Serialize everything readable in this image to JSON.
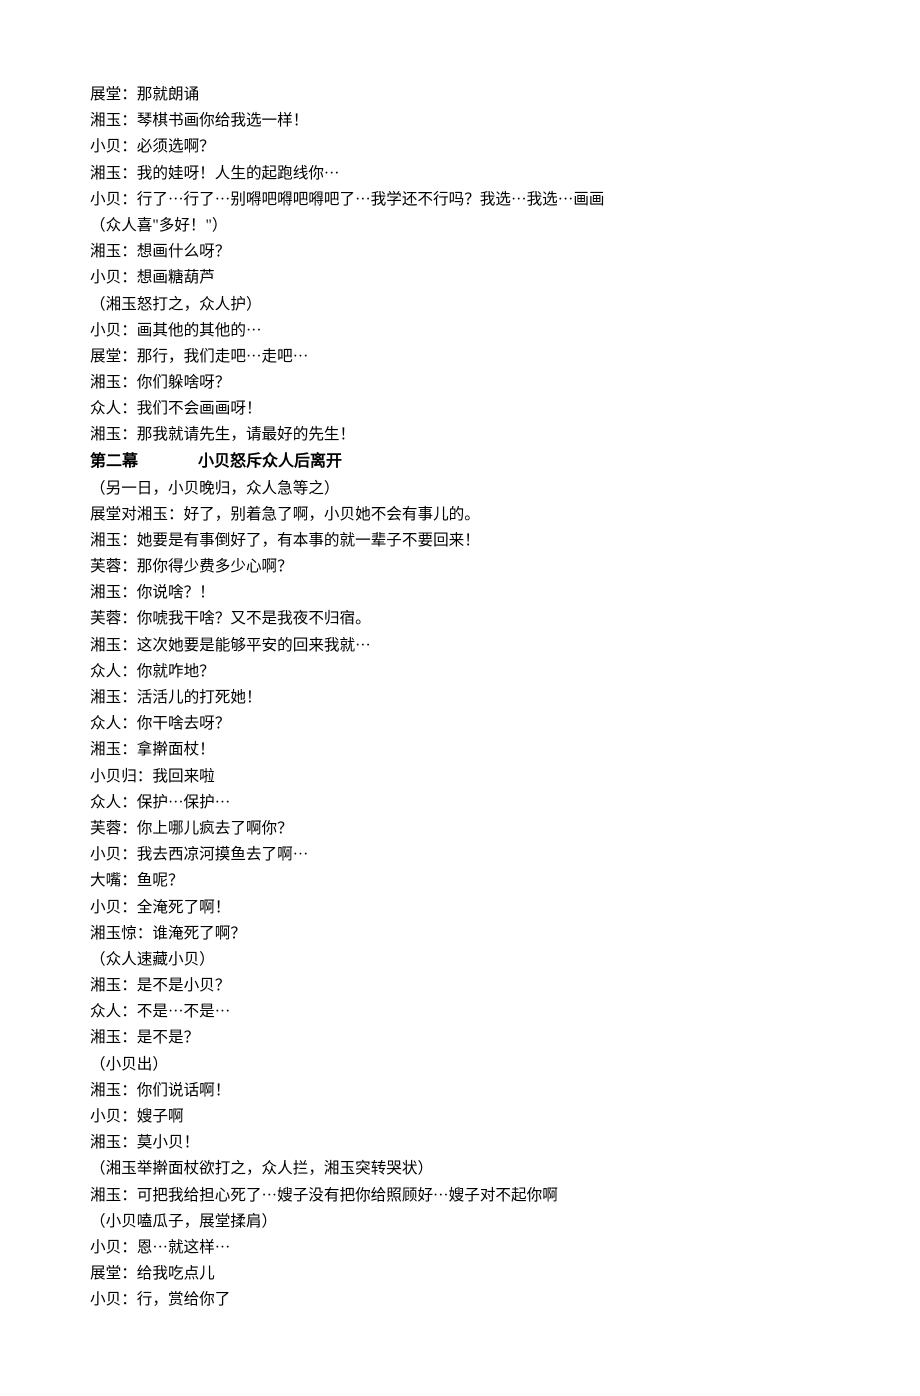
{
  "lines": [
    {
      "t": "展堂：那就朗诵"
    },
    {
      "t": "湘玉：琴棋书画你给我选一样！"
    },
    {
      "t": "小贝：必须选啊？"
    },
    {
      "t": "湘玉：我的娃呀！人生的起跑线你···"
    },
    {
      "t": "小贝：行了···行了···别嘚吧嘚吧嘚吧了···我学还不行吗？我选···我选···画画"
    },
    {
      "t": "（众人喜\"多好！\"）"
    },
    {
      "t": "湘玉：想画什么呀？"
    },
    {
      "t": "小贝：想画糖葫芦"
    },
    {
      "t": "（湘玉怒打之，众人护）"
    },
    {
      "t": "小贝：画其他的其他的···"
    },
    {
      "t": "展堂：那行，我们走吧···走吧···"
    },
    {
      "t": "湘玉：你们躲啥呀？"
    },
    {
      "t": "众人：我们不会画画呀！"
    },
    {
      "t": "湘玉：那我就请先生，请最好的先生！"
    },
    {
      "t": "第二幕",
      "t2": "小贝怒斥众人后离开",
      "h": true
    },
    {
      "t": "（另一日，小贝晚归，众人急等之）"
    },
    {
      "t": "展堂对湘玉：好了，别着急了啊，小贝她不会有事儿的。"
    },
    {
      "t": "湘玉：她要是有事倒好了，有本事的就一辈子不要回来！"
    },
    {
      "t": "芙蓉：那你得少费多少心啊？"
    },
    {
      "t": "湘玉：你说啥？！"
    },
    {
      "t": "芙蓉：你唬我干啥？又不是我夜不归宿。"
    },
    {
      "t": "湘玉：这次她要是能够平安的回来我就···"
    },
    {
      "t": "众人：你就咋地？"
    },
    {
      "t": "湘玉：活活儿的打死她！"
    },
    {
      "t": "众人：你干啥去呀？"
    },
    {
      "t": "湘玉：拿擀面杖！"
    },
    {
      "t": "小贝归：我回来啦"
    },
    {
      "t": "众人：保护···保护···"
    },
    {
      "t": "芙蓉：你上哪儿疯去了啊你？"
    },
    {
      "t": "小贝：我去西凉河摸鱼去了啊···"
    },
    {
      "t": "大嘴：鱼呢？"
    },
    {
      "t": "小贝：全淹死了啊！"
    },
    {
      "t": "湘玉惊：谁淹死了啊？"
    },
    {
      "t": "（众人速藏小贝）"
    },
    {
      "t": "湘玉：是不是小贝？"
    },
    {
      "t": "众人：不是···不是···"
    },
    {
      "t": "湘玉：是不是？"
    },
    {
      "t": "（小贝出）"
    },
    {
      "t": "湘玉：你们说话啊！"
    },
    {
      "t": "小贝：嫂子啊"
    },
    {
      "t": "湘玉：莫小贝！"
    },
    {
      "t": "（湘玉举擀面杖欲打之，众人拦，湘玉突转哭状）"
    },
    {
      "t": "湘玉：可把我给担心死了···嫂子没有把你给照顾好···嫂子对不起你啊"
    },
    {
      "t": "（小贝嗑瓜子，展堂揉肩）"
    },
    {
      "t": "小贝：恩···就这样···"
    },
    {
      "t": "展堂：给我吃点儿"
    },
    {
      "t": "小贝：行，赏给你了"
    }
  ]
}
